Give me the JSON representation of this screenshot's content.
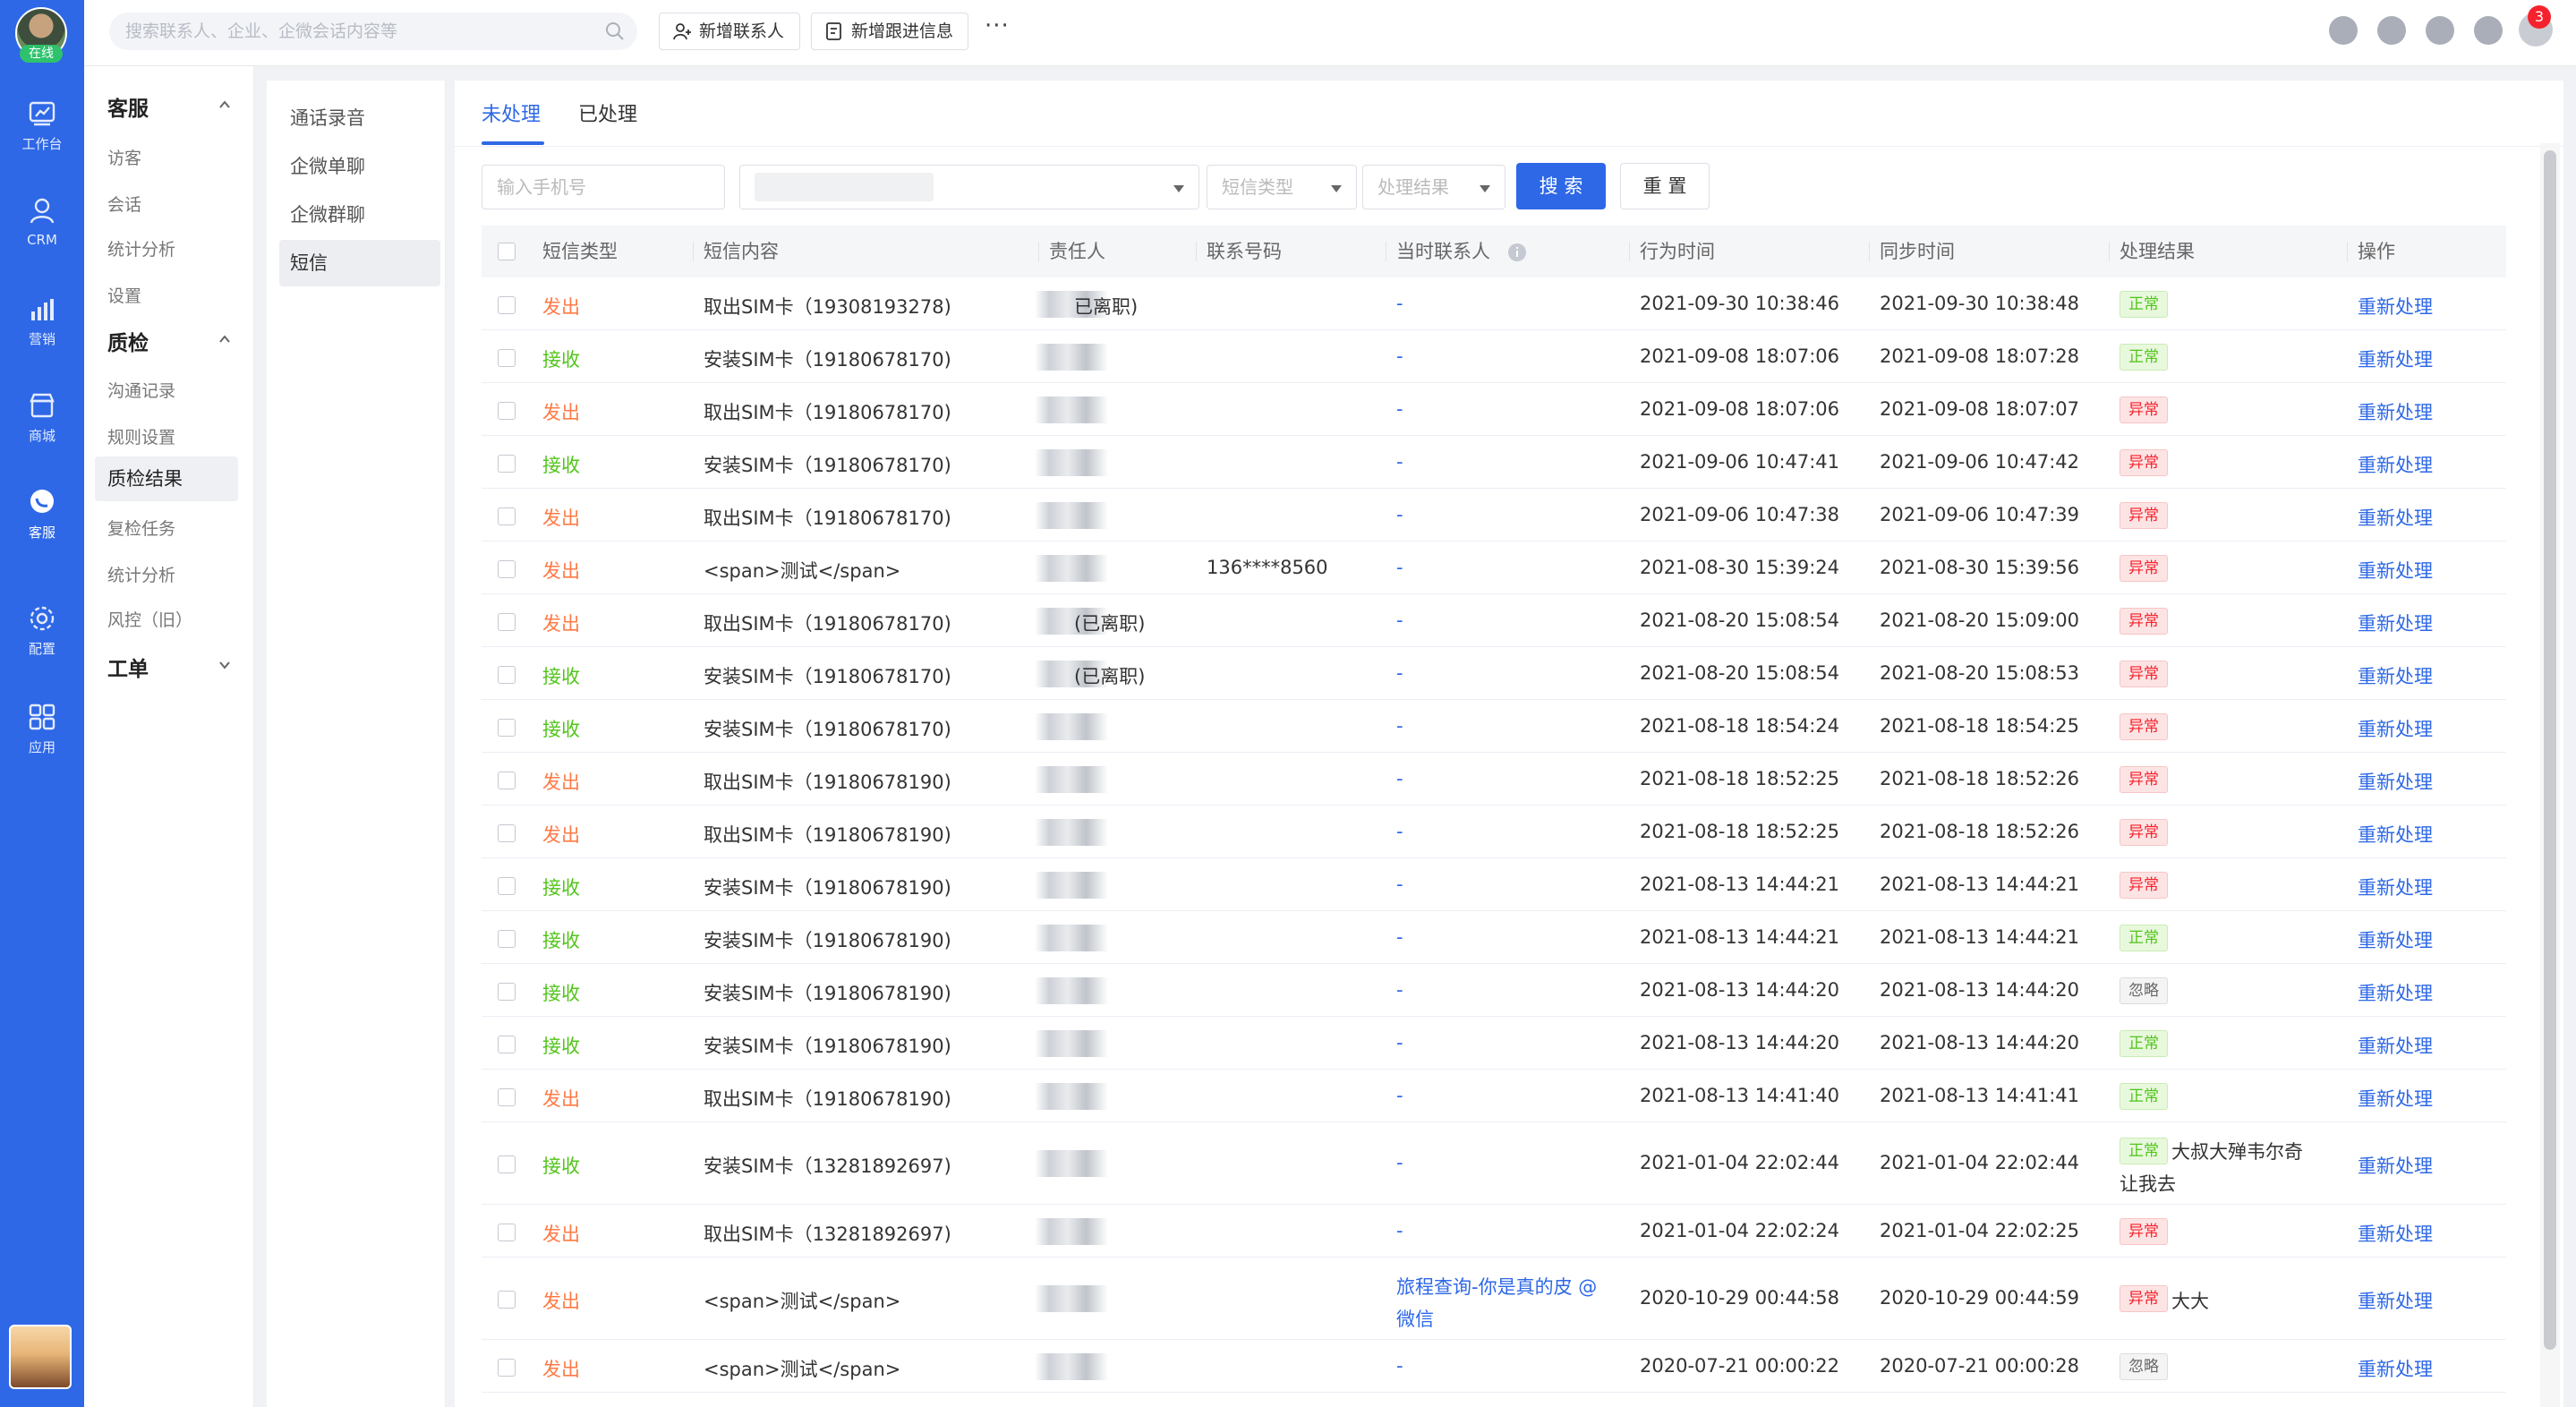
{
  "app": {
    "status_label": "在线",
    "search_placeholder": "搜索联系人、企业、企微会话内容等",
    "add_contact": "新增联系人",
    "add_followup": "新增跟进信息",
    "more": "···",
    "notification_count": "3"
  },
  "rail": [
    {
      "label": "工作台",
      "icon": "workbench-icon"
    },
    {
      "label": "CRM",
      "icon": "person-icon"
    },
    {
      "label": "营销",
      "icon": "chart-icon"
    },
    {
      "label": "商城",
      "icon": "store-icon"
    },
    {
      "label": "客服",
      "icon": "chat-icon",
      "active": true
    },
    {
      "label": "配置",
      "icon": "gear-icon"
    },
    {
      "label": "应用",
      "icon": "apps-icon"
    }
  ],
  "submenu": {
    "group1": "客服",
    "g1_items": [
      "访客",
      "会话",
      "统计分析",
      "设置"
    ],
    "group2": "质检",
    "g2_items": [
      "沟通记录",
      "规则设置",
      "质检结果",
      "复检任务",
      "统计分析",
      "风控（旧）"
    ],
    "group3": "工单"
  },
  "thirdmenu": [
    "通话录音",
    "企微单聊",
    "企微群聊",
    "短信"
  ],
  "tabs": [
    "未处理",
    "已处理"
  ],
  "filters": {
    "phone_placeholder": "输入手机号",
    "type_placeholder": "短信类型",
    "result_placeholder": "处理结果",
    "search_btn": "搜 索",
    "reset_btn": "重 置"
  },
  "table": {
    "headers": [
      "短信类型",
      "短信内容",
      "责任人",
      "联系号码",
      "当时联系人",
      "行为时间",
      "同步时间",
      "处理结果",
      "操作"
    ],
    "action_label": "重新处理",
    "rows": [
      {
        "type": "发出",
        "content": "取出SIM卡（19308193278)",
        "owner": "已离职)",
        "phone": "",
        "contact": "-",
        "t1": "2021-09-30 10:38:46",
        "t2": "2021-09-30 10:38:48",
        "result": "正常",
        "note": ""
      },
      {
        "type": "接收",
        "content": "安装SIM卡（19180678170)",
        "owner": "",
        "phone": "",
        "contact": "-",
        "t1": "2021-09-08 18:07:06",
        "t2": "2021-09-08 18:07:28",
        "result": "正常",
        "note": ""
      },
      {
        "type": "发出",
        "content": "取出SIM卡（19180678170)",
        "owner": "",
        "phone": "",
        "contact": "-",
        "t1": "2021-09-08 18:07:06",
        "t2": "2021-09-08 18:07:07",
        "result": "异常",
        "note": ""
      },
      {
        "type": "接收",
        "content": "安装SIM卡（19180678170)",
        "owner": "",
        "phone": "",
        "contact": "-",
        "t1": "2021-09-06 10:47:41",
        "t2": "2021-09-06 10:47:42",
        "result": "异常",
        "note": ""
      },
      {
        "type": "发出",
        "content": "取出SIM卡（19180678170)",
        "owner": "",
        "phone": "",
        "contact": "-",
        "t1": "2021-09-06 10:47:38",
        "t2": "2021-09-06 10:47:39",
        "result": "异常",
        "note": ""
      },
      {
        "type": "发出",
        "content": "<span>测试</span>",
        "owner": "",
        "phone": "136****8560",
        "contact": "-",
        "t1": "2021-08-30 15:39:24",
        "t2": "2021-08-30 15:39:56",
        "result": "异常",
        "note": ""
      },
      {
        "type": "发出",
        "content": "取出SIM卡（19180678170)",
        "owner": "(已离职)",
        "phone": "",
        "contact": "-",
        "t1": "2021-08-20 15:08:54",
        "t2": "2021-08-20 15:09:00",
        "result": "异常",
        "note": ""
      },
      {
        "type": "接收",
        "content": "安装SIM卡（19180678170)",
        "owner": "(已离职)",
        "phone": "",
        "contact": "-",
        "t1": "2021-08-20 15:08:54",
        "t2": "2021-08-20 15:08:53",
        "result": "异常",
        "note": ""
      },
      {
        "type": "接收",
        "content": "安装SIM卡（19180678170)",
        "owner": "",
        "phone": "",
        "contact": "-",
        "t1": "2021-08-18 18:54:24",
        "t2": "2021-08-18 18:54:25",
        "result": "异常",
        "note": ""
      },
      {
        "type": "发出",
        "content": "取出SIM卡（19180678190)",
        "owner": "",
        "phone": "",
        "contact": "-",
        "t1": "2021-08-18 18:52:25",
        "t2": "2021-08-18 18:52:26",
        "result": "异常",
        "note": ""
      },
      {
        "type": "发出",
        "content": "取出SIM卡（19180678190)",
        "owner": "",
        "phone": "",
        "contact": "-",
        "t1": "2021-08-18 18:52:25",
        "t2": "2021-08-18 18:52:26",
        "result": "异常",
        "note": ""
      },
      {
        "type": "接收",
        "content": "安装SIM卡（19180678190)",
        "owner": "",
        "phone": "",
        "contact": "-",
        "t1": "2021-08-13 14:44:21",
        "t2": "2021-08-13 14:44:21",
        "result": "异常",
        "note": ""
      },
      {
        "type": "接收",
        "content": "安装SIM卡（19180678190)",
        "owner": "",
        "phone": "",
        "contact": "-",
        "t1": "2021-08-13 14:44:21",
        "t2": "2021-08-13 14:44:21",
        "result": "正常",
        "note": ""
      },
      {
        "type": "接收",
        "content": "安装SIM卡（19180678190)",
        "owner": "",
        "phone": "",
        "contact": "-",
        "t1": "2021-08-13 14:44:20",
        "t2": "2021-08-13 14:44:20",
        "result": "忽略",
        "note": ""
      },
      {
        "type": "接收",
        "content": "安装SIM卡（19180678190)",
        "owner": "",
        "phone": "",
        "contact": "-",
        "t1": "2021-08-13 14:44:20",
        "t2": "2021-08-13 14:44:20",
        "result": "正常",
        "note": ""
      },
      {
        "type": "发出",
        "content": "取出SIM卡（19180678190)",
        "owner": "",
        "phone": "",
        "contact": "-",
        "t1": "2021-08-13 14:41:40",
        "t2": "2021-08-13 14:41:41",
        "result": "正常",
        "note": ""
      },
      {
        "type": "接收",
        "content": "安装SIM卡（13281892697)",
        "owner": "",
        "phone": "",
        "contact": "-",
        "t1": "2021-01-04 22:02:44",
        "t2": "2021-01-04 22:02:44",
        "result": "正常",
        "note": "大叔大殚韦尔奇",
        "note2": "让我去"
      },
      {
        "type": "发出",
        "content": "取出SIM卡（13281892697)",
        "owner": "",
        "phone": "",
        "contact": "-",
        "t1": "2021-01-04 22:02:24",
        "t2": "2021-01-04 22:02:25",
        "result": "异常",
        "note": ""
      },
      {
        "type": "发出",
        "content": "<span>测试</span>",
        "owner": "",
        "phone": "",
        "contact": "旅程查询-你是真的皮 @",
        "contact2": "微信",
        "t1": "2020-10-29 00:44:58",
        "t2": "2020-10-29 00:44:59",
        "result": "异常",
        "note": "大大"
      },
      {
        "type": "发出",
        "content": "<span>测试</span>",
        "owner": "",
        "phone": "",
        "contact": "-",
        "t1": "2020-07-21 00:00:22",
        "t2": "2020-07-21 00:00:28",
        "result": "忽略",
        "note": ""
      }
    ]
  },
  "colors": {
    "primary": "#2e68e6",
    "send": "#ff7a45",
    "receive": "#52c41a",
    "normal": "#52c41a",
    "abnormal": "#f5222d"
  }
}
